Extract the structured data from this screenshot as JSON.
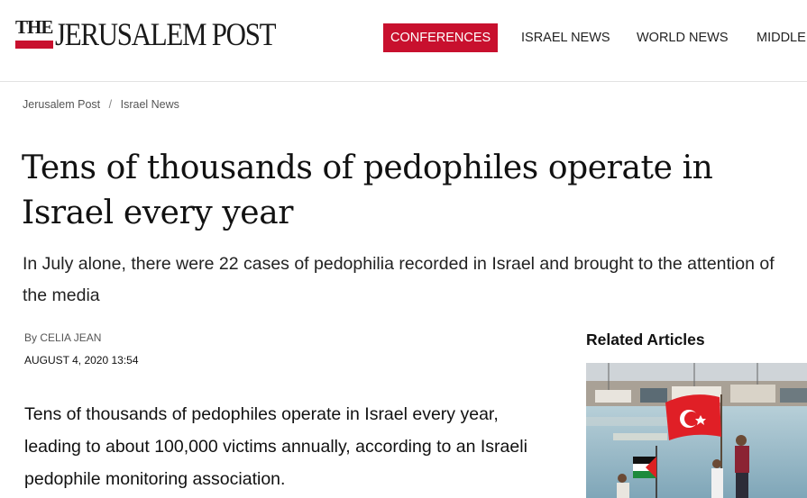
{
  "header": {
    "logo": {
      "the": "THE",
      "name": "JERUSALEM POST"
    },
    "nav": [
      {
        "label": "CONFERENCES",
        "active": true
      },
      {
        "label": "ISRAEL NEWS",
        "active": false
      },
      {
        "label": "WORLD NEWS",
        "active": false
      },
      {
        "label": "MIDDLE",
        "active": false
      }
    ]
  },
  "breadcrumb": {
    "items": [
      "Jerusalem Post",
      "Israel News"
    ],
    "separator": "/"
  },
  "article": {
    "title": "Tens of thousands of pedophiles operate in Israel every year",
    "subtitle": "In July alone, there were 22 cases of pedophilia recorded in Israel and brought to the attention of the media",
    "byline_prefix": "By",
    "author": "CELIA JEAN",
    "date": "AUGUST 4, 2020 13:54",
    "body_first": "Tens of thousands of pedophiles operate in Israel every year, leading to about 100,000 victims annually, according to an Israeli pedophile monitoring association."
  },
  "sidebar": {
    "related_heading": "Related Articles"
  },
  "colors": {
    "brand_red": "#c8102e",
    "sea": "#8fb8c9",
    "sky": "#d9dde0"
  },
  "icons": {
    "related_image": "boats-with-flags-photo"
  }
}
